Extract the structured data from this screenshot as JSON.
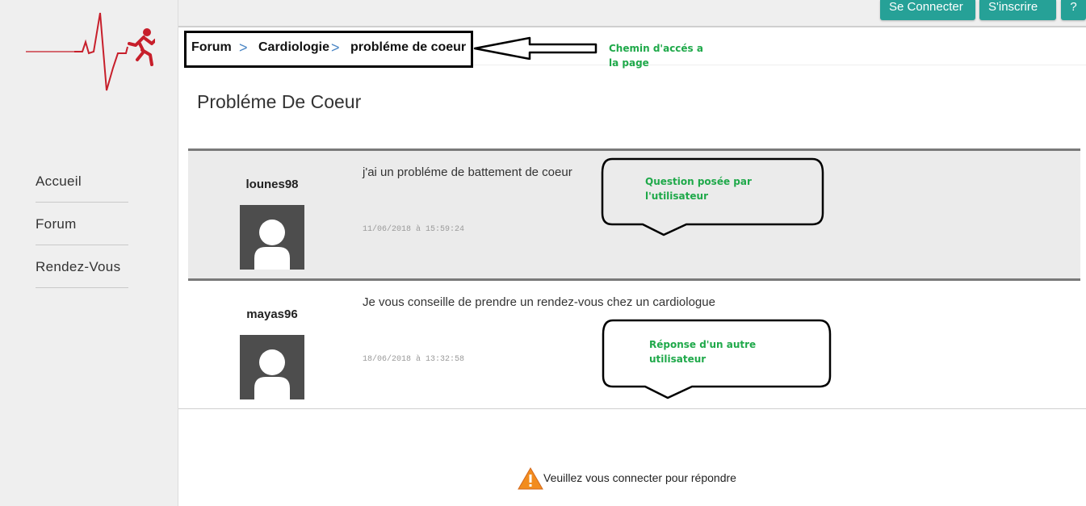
{
  "sidebar": {
    "logo_icon": "heartbeat-runner-logo",
    "items": [
      {
        "label": "Accueil"
      },
      {
        "label": "Forum"
      },
      {
        "label": "Rendez-Vous"
      }
    ]
  },
  "topbar": {
    "login_label": "Se Connecter",
    "signup_label": "S'inscrire",
    "help_label": "?",
    "accent_color": "#26a197"
  },
  "breadcrumb": {
    "items": [
      "Forum",
      "Cardiologie",
      "probléme de coeur"
    ],
    "separator": ">"
  },
  "annotations": {
    "path_note": "Chemin d'accés a la page",
    "question_note": "Question posée par l'utilisateur",
    "answer_note": "Réponse d'un autre utilisateur",
    "annotation_color": "#1fa94a"
  },
  "page": {
    "title": "Probléme De Coeur"
  },
  "posts": [
    {
      "author": "lounes98",
      "message": "j'ai un probléme de battement de coeur",
      "date": "11/06/2018 à 15:59:24"
    },
    {
      "author": "mayas96",
      "message": "Je vous conseille de prendre un rendez-vous chez un cardiologue",
      "date": "18/06/2018 à 13:32:58"
    }
  ],
  "notice": {
    "icon": "warning-icon",
    "text": "Veuillez vous connecter pour répondre"
  }
}
